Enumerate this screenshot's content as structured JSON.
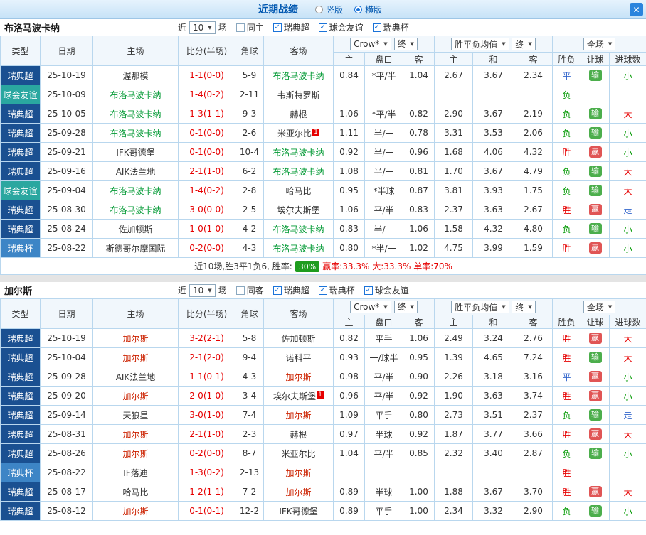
{
  "titlebar": {
    "title": "近期战绩",
    "vertical_label": "竖版",
    "horizontal_label": "横版",
    "close_label": "✕"
  },
  "table_header": {
    "type": "类型",
    "date": "日期",
    "home": "主场",
    "score": "比分(半场)",
    "corner": "角球",
    "away": "客场",
    "odds_home": "主",
    "odds_handicap": "盘口",
    "odds_away": "客",
    "avg_home": "主",
    "avg_draw": "和",
    "avg_away": "客",
    "result_spf": "胜负",
    "result_handicap": "让球",
    "result_goals": "进球数",
    "company_select": "Crow*",
    "final_select": "终",
    "avg_select": "胜平负均值",
    "scope_select": "全场"
  },
  "league_colors": {
    "瑞典超": "#1a5091",
    "球会友谊": "#2aa7a0",
    "瑞典杯": "#3d85c6"
  },
  "sections": [
    {
      "team": "布洛马波卡纳",
      "focus_color": "#009933",
      "filter": {
        "prefix": "近",
        "count": "10",
        "suffix": "场",
        "same_label": "同主",
        "leagues": [
          "瑞典超",
          "球会友谊",
          "瑞典杯"
        ]
      },
      "rows": [
        {
          "type": "瑞典超",
          "date": "25-10-19",
          "home": "渥那模",
          "home_focus": false,
          "home_redcard": false,
          "score": "1-1(0-0)",
          "corner": "5-9",
          "away": "布洛马波卡纳",
          "away_focus": true,
          "away_redcard": false,
          "odds": [
            "0.84",
            "*平/半",
            "1.04"
          ],
          "avg": [
            "2.67",
            "3.67",
            "2.34"
          ],
          "spf": "平",
          "rq": "输",
          "jqs": "小"
        },
        {
          "type": "球会友谊",
          "date": "25-10-09",
          "home": "布洛马波卡纳",
          "home_focus": true,
          "home_redcard": false,
          "score": "1-4(0-2)",
          "corner": "2-11",
          "away": "韦斯特罗斯",
          "away_focus": false,
          "away_redcard": false,
          "odds": [
            "",
            "",
            ""
          ],
          "avg": [
            "",
            "",
            ""
          ],
          "spf": "负",
          "rq": "",
          "jqs": ""
        },
        {
          "type": "瑞典超",
          "date": "25-10-05",
          "home": "布洛马波卡纳",
          "home_focus": true,
          "home_redcard": false,
          "score": "1-3(1-1)",
          "corner": "9-3",
          "away": "赫根",
          "away_focus": false,
          "away_redcard": false,
          "odds": [
            "1.06",
            "*平/半",
            "0.82"
          ],
          "avg": [
            "2.90",
            "3.67",
            "2.19"
          ],
          "spf": "负",
          "rq": "输",
          "jqs": "大"
        },
        {
          "type": "瑞典超",
          "date": "25-09-28",
          "home": "布洛马波卡纳",
          "home_focus": true,
          "home_redcard": false,
          "score": "0-1(0-0)",
          "corner": "2-6",
          "away": "米亚尔比",
          "away_focus": false,
          "away_redcard": true,
          "odds": [
            "1.11",
            "半/一",
            "0.78"
          ],
          "avg": [
            "3.31",
            "3.53",
            "2.06"
          ],
          "spf": "负",
          "rq": "输",
          "jqs": "小"
        },
        {
          "type": "瑞典超",
          "date": "25-09-21",
          "home": "IFK哥德堡",
          "home_focus": false,
          "home_redcard": false,
          "score": "0-1(0-0)",
          "corner": "10-4",
          "away": "布洛马波卡纳",
          "away_focus": true,
          "away_redcard": false,
          "odds": [
            "0.92",
            "半/一",
            "0.96"
          ],
          "avg": [
            "1.68",
            "4.06",
            "4.32"
          ],
          "spf": "胜",
          "rq": "赢",
          "jqs": "小"
        },
        {
          "type": "瑞典超",
          "date": "25-09-16",
          "home": "AIK法兰地",
          "home_focus": false,
          "home_redcard": false,
          "score": "2-1(1-0)",
          "corner": "6-2",
          "away": "布洛马波卡纳",
          "away_focus": true,
          "away_redcard": false,
          "odds": [
            "1.08",
            "半/一",
            "0.81"
          ],
          "avg": [
            "1.70",
            "3.67",
            "4.79"
          ],
          "spf": "负",
          "rq": "输",
          "jqs": "大"
        },
        {
          "type": "球会友谊",
          "date": "25-09-04",
          "home": "布洛马波卡纳",
          "home_focus": true,
          "home_redcard": false,
          "score": "1-4(0-2)",
          "corner": "2-8",
          "away": "哈马比",
          "away_focus": false,
          "away_redcard": false,
          "odds": [
            "0.95",
            "*半球",
            "0.87"
          ],
          "avg": [
            "3.81",
            "3.93",
            "1.75"
          ],
          "spf": "负",
          "rq": "输",
          "jqs": "大"
        },
        {
          "type": "瑞典超",
          "date": "25-08-30",
          "home": "布洛马波卡纳",
          "home_focus": true,
          "home_redcard": false,
          "score": "3-0(0-0)",
          "corner": "2-5",
          "away": "埃尔夫斯堡",
          "away_focus": false,
          "away_redcard": false,
          "odds": [
            "1.06",
            "平/半",
            "0.83"
          ],
          "avg": [
            "2.37",
            "3.63",
            "2.67"
          ],
          "spf": "胜",
          "rq": "赢",
          "jqs": "走"
        },
        {
          "type": "瑞典超",
          "date": "25-08-24",
          "home": "佐加顿斯",
          "home_focus": false,
          "home_redcard": false,
          "score": "1-0(1-0)",
          "corner": "4-2",
          "away": "布洛马波卡纳",
          "away_focus": true,
          "away_redcard": false,
          "odds": [
            "0.83",
            "半/一",
            "1.06"
          ],
          "avg": [
            "1.58",
            "4.32",
            "4.80"
          ],
          "spf": "负",
          "rq": "输",
          "jqs": "小"
        },
        {
          "type": "瑞典杯",
          "date": "25-08-22",
          "home": "斯德哥尔摩国际",
          "home_focus": false,
          "home_redcard": false,
          "score": "0-2(0-0)",
          "corner": "4-3",
          "away": "布洛马波卡纳",
          "away_focus": true,
          "away_redcard": false,
          "odds": [
            "0.80",
            "*半/一",
            "1.02"
          ],
          "avg": [
            "4.75",
            "3.99",
            "1.59"
          ],
          "spf": "胜",
          "rq": "赢",
          "jqs": "小"
        }
      ],
      "summary": {
        "text": "近10场,胜3平1负6, 胜率:",
        "rate": "30%",
        "extra": "赢率:33.3% 大:33.3% 单率:70%"
      }
    },
    {
      "team": "加尔斯",
      "focus_color": "#cc2200",
      "filter": {
        "prefix": "近",
        "count": "10",
        "suffix": "场",
        "same_label": "同客",
        "leagues": [
          "瑞典超",
          "瑞典杯",
          "球会友谊"
        ]
      },
      "rows": [
        {
          "type": "瑞典超",
          "date": "25-10-19",
          "home": "加尔斯",
          "home_focus": true,
          "home_redcard": false,
          "score": "3-2(2-1)",
          "corner": "5-8",
          "away": "佐加顿斯",
          "away_focus": false,
          "away_redcard": false,
          "odds": [
            "0.82",
            "平手",
            "1.06"
          ],
          "avg": [
            "2.49",
            "3.24",
            "2.76"
          ],
          "spf": "胜",
          "rq": "赢",
          "jqs": "大"
        },
        {
          "type": "瑞典超",
          "date": "25-10-04",
          "home": "加尔斯",
          "home_focus": true,
          "home_redcard": false,
          "score": "2-1(2-0)",
          "corner": "9-4",
          "away": "诺科平",
          "away_focus": false,
          "away_redcard": false,
          "odds": [
            "0.93",
            "一/球半",
            "0.95"
          ],
          "avg": [
            "1.39",
            "4.65",
            "7.24"
          ],
          "spf": "胜",
          "rq": "输",
          "jqs": "大"
        },
        {
          "type": "瑞典超",
          "date": "25-09-28",
          "home": "AIK法兰地",
          "home_focus": false,
          "home_redcard": false,
          "score": "1-1(0-1)",
          "corner": "4-3",
          "away": "加尔斯",
          "away_focus": true,
          "away_redcard": false,
          "odds": [
            "0.98",
            "平/半",
            "0.90"
          ],
          "avg": [
            "2.26",
            "3.18",
            "3.16"
          ],
          "spf": "平",
          "rq": "赢",
          "jqs": "小"
        },
        {
          "type": "瑞典超",
          "date": "25-09-20",
          "home": "加尔斯",
          "home_focus": true,
          "home_redcard": false,
          "score": "2-0(1-0)",
          "corner": "3-4",
          "away": "埃尔夫斯堡",
          "away_focus": false,
          "away_redcard": true,
          "odds": [
            "0.96",
            "平/半",
            "0.92"
          ],
          "avg": [
            "1.90",
            "3.63",
            "3.74"
          ],
          "spf": "胜",
          "rq": "赢",
          "jqs": "小"
        },
        {
          "type": "瑞典超",
          "date": "25-09-14",
          "home": "天狼星",
          "home_focus": false,
          "home_redcard": false,
          "score": "3-0(1-0)",
          "corner": "7-4",
          "away": "加尔斯",
          "away_focus": true,
          "away_redcard": false,
          "odds": [
            "1.09",
            "平手",
            "0.80"
          ],
          "avg": [
            "2.73",
            "3.51",
            "2.37"
          ],
          "spf": "负",
          "rq": "输",
          "jqs": "走"
        },
        {
          "type": "瑞典超",
          "date": "25-08-31",
          "home": "加尔斯",
          "home_focus": true,
          "home_redcard": false,
          "score": "2-1(1-0)",
          "corner": "2-3",
          "away": "赫根",
          "away_focus": false,
          "away_redcard": false,
          "odds": [
            "0.97",
            "半球",
            "0.92"
          ],
          "avg": [
            "1.87",
            "3.77",
            "3.66"
          ],
          "spf": "胜",
          "rq": "赢",
          "jqs": "大"
        },
        {
          "type": "瑞典超",
          "date": "25-08-26",
          "home": "加尔斯",
          "home_focus": true,
          "home_redcard": false,
          "score": "0-2(0-0)",
          "corner": "8-7",
          "away": "米亚尔比",
          "away_focus": false,
          "away_redcard": false,
          "odds": [
            "1.04",
            "平/半",
            "0.85"
          ],
          "avg": [
            "2.32",
            "3.40",
            "2.87"
          ],
          "spf": "负",
          "rq": "输",
          "jqs": "小"
        },
        {
          "type": "瑞典杯",
          "date": "25-08-22",
          "home": "IF落迪",
          "home_focus": false,
          "home_redcard": false,
          "score": "1-3(0-2)",
          "corner": "2-13",
          "away": "加尔斯",
          "away_focus": true,
          "away_redcard": false,
          "odds": [
            "",
            "",
            ""
          ],
          "avg": [
            "",
            "",
            ""
          ],
          "spf": "胜",
          "rq": "",
          "jqs": ""
        },
        {
          "type": "瑞典超",
          "date": "25-08-17",
          "home": "哈马比",
          "home_focus": false,
          "home_redcard": false,
          "score": "1-2(1-1)",
          "corner": "7-2",
          "away": "加尔斯",
          "away_focus": true,
          "away_redcard": false,
          "odds": [
            "0.89",
            "半球",
            "1.00"
          ],
          "avg": [
            "1.88",
            "3.67",
            "3.70"
          ],
          "spf": "胜",
          "rq": "赢",
          "jqs": "大"
        },
        {
          "type": "瑞典超",
          "date": "25-08-12",
          "home": "加尔斯",
          "home_focus": true,
          "home_redcard": false,
          "score": "0-1(0-1)",
          "corner": "12-2",
          "away": "IFK哥德堡",
          "away_focus": false,
          "away_redcard": false,
          "odds": [
            "0.89",
            "平手",
            "1.00"
          ],
          "avg": [
            "2.34",
            "3.32",
            "2.90"
          ],
          "spf": "负",
          "rq": "输",
          "jqs": "小"
        }
      ],
      "summary": null
    }
  ]
}
